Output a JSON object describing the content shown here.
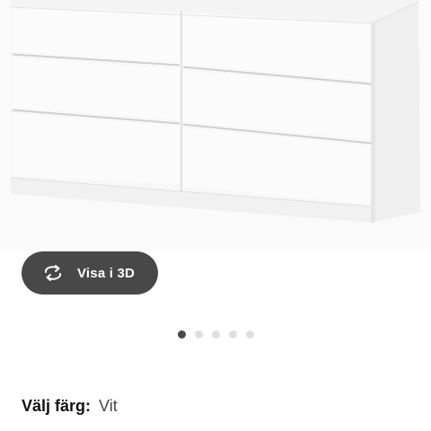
{
  "product_image": {
    "alt": "white six-drawer chest"
  },
  "view_3d_button": {
    "label": "Visa i 3D",
    "icon": "rotate-3d-icon"
  },
  "carousel": {
    "total_dots": 5,
    "active_index": 0
  },
  "color_selector": {
    "label": "Välj färg:",
    "value": "Vit"
  },
  "colors": {
    "button_bg": "#484848",
    "dot_active": "#484848",
    "dot_inactive": "#dfdfdf"
  }
}
